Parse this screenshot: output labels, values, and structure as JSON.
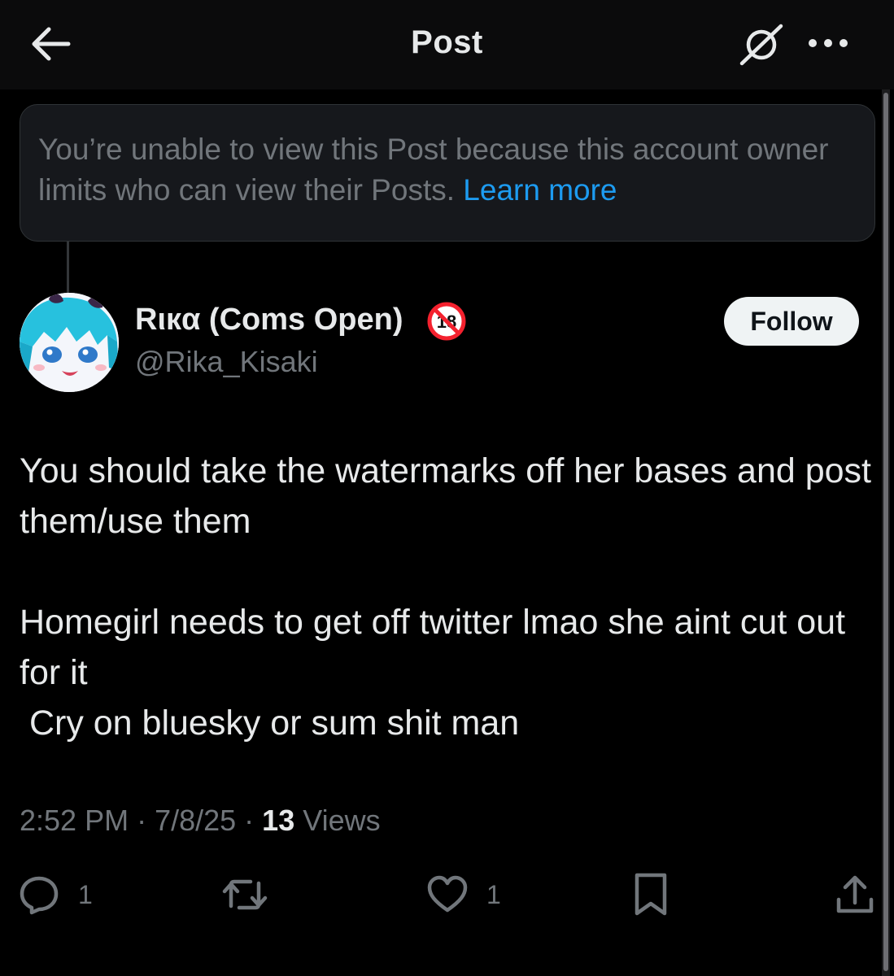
{
  "header": {
    "title": "Post",
    "back_icon": "arrow-left-icon",
    "grok_icon": "slashed-circle-icon",
    "more_icon": "more-dots-icon"
  },
  "notice": {
    "text": "You’re unable to view this Post because this account owner limits who can view their Posts. ",
    "link_label": "Learn more"
  },
  "author": {
    "display_name": "Rιкα (Coms Open)",
    "badge_icon": "no-under-18-icon",
    "badge_text": "18",
    "handle": "@Rika_Kisaki",
    "follow_label": "Follow"
  },
  "post": {
    "text": "You should take the watermarks off her bases and post them/use them\n\nHomegirl needs to get off twitter lmao she aint cut out for it\n Cry on bluesky or sum shit man"
  },
  "meta": {
    "time": "2:52 PM",
    "sep": " · ",
    "date": "7/8/25",
    "views_count": "13",
    "views_label": " Views"
  },
  "actions": {
    "reply_count": "1",
    "like_count": "1"
  },
  "colors": {
    "background": "#000000",
    "text": "#e7e9ea",
    "muted": "#71767b",
    "link": "#1d9bf0",
    "badge": "#f4212e"
  }
}
